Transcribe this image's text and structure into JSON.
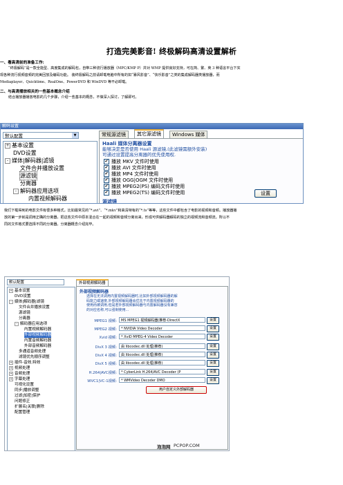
{
  "title": "打造完美影音! 终极解码高清设置解析",
  "section1": {
    "heading": "一、看高清前的准备工作:",
    "lines": [
      "“终极解码”是一款全能型、高度集成的解码包，自带三种流行播放器（MPC/KMP P）并对 WMP 提供良好支持，可在简、繁、英 3 种语言平台下实",
      "现各种流行视频音频的完美回放及编码功能。 装终极解码之前请卸载电脑中所有的如“暴风影音”、“快乐影音”之类的集成解码器类播放器，而",
      "Mediaplayer、Quicktime、RealOne、PowerDVD 和 WinDVD 等不必卸载。"
    ]
  },
  "section2": {
    "heading": "二、与高清播放相关的一些基本概念介绍",
    "line": "结合播放器播放电影的几个步骤，介绍一些基本的概念，不做深入探讨，了解即可。"
  },
  "screenshot1": {
    "window_title": "解码设置",
    "profile": "默认配置",
    "tree": [
      {
        "text": "基本设置",
        "box": "+"
      },
      {
        "text": "DVD设置",
        "box": ""
      },
      {
        "text": "媒体|解码器|滤镜",
        "box": "-"
      },
      {
        "text": "文件合并播放设置",
        "box": ""
      },
      {
        "text": "源滤镜",
        "box": "",
        "selected": true
      },
      {
        "text": "分离器",
        "box": ""
      },
      {
        "text": "解码器应用选项",
        "box": "-"
      },
      {
        "text": "内置视频解码器",
        "box": ""
      },
      {
        "text": "外部视频解码器",
        "box": ""
      },
      {
        "text": "内置音频解码器",
        "box": ""
      },
      {
        "text": "外部音频解码器",
        "box": ""
      },
      {
        "text": "多通道音频处理",
        "box": ""
      }
    ],
    "tabs": [
      "常规源滤镜",
      "其它源滤镜",
      "Windows 媒体"
    ],
    "group_title": "Haali 媒体分离器设置",
    "group_desc": [
      "能够决定是否使用 Haali 源滤镜,(此滤镜需额外安装)",
      "可通过设置提高分离器的优先使用权."
    ],
    "options": [
      "播放 MKV 文件时使用",
      "播放 AVI 文件时使用",
      "播放 MP4 文件时使用",
      "播放 OGG|OGM 文件时使用",
      "播放 MPEG2(PS) 编码文件时使用",
      "播放 MPEG2(TS) 编码文件时使用"
    ],
    "settings_button": "设置",
    "next_group_title": "源滤镜"
  },
  "paragraph3": [
    "我们下载得到的电影文件有很多种格式，比如最常见的“*.avi”、“*.mkv”和高清特有的“*.ts”等等，这些文件中都包含了电影的视频和音频。播放器播",
    "放的第一步就是调用正确的分离器，把这些文件中原本混合在一起的视频和音频分离出来，形成可供解码器解码的独立的视频流和音频流。所以不",
    "同的文件格式要选择不同的分离器。分离器概念介绍完毕。"
  ],
  "screenshot2": {
    "profile": "默认配置",
    "tab": "外部视频解码器",
    "tree": [
      {
        "text": "基本设置",
        "box": "+"
      },
      {
        "text": "DVD设置",
        "box": ""
      },
      {
        "text": "媒体|解码器|滤镜",
        "box": "-"
      },
      {
        "text": "文件合并播放设置",
        "box": ""
      },
      {
        "text": "源滤镜",
        "box": ""
      },
      {
        "text": "分离器",
        "box": ""
      },
      {
        "text": "解码器应用选项",
        "box": "-"
      },
      {
        "text": "内置视频解码器",
        "box": ""
      },
      {
        "text": "外部视频解码器",
        "box": "",
        "selected": true
      },
      {
        "text": "内置音频解码器",
        "box": ""
      },
      {
        "text": "外部音频解码器",
        "box": ""
      },
      {
        "text": "多通道音频处理",
        "box": ""
      },
      {
        "text": "滤镜优先顺序调整",
        "box": ""
      },
      {
        "text": "插件-音效,特效",
        "box": "+"
      },
      {
        "text": "视频处理",
        "box": "+"
      },
      {
        "text": "音频处理",
        "box": "+"
      },
      {
        "text": "字幕处理",
        "box": "+"
      },
      {
        "text": "可视化设置",
        "box": ""
      },
      {
        "text": "同步|播放调整",
        "box": ""
      },
      {
        "text": "过滤|加密|保护",
        "box": ""
      },
      {
        "text": "问题修正",
        "box": ""
      },
      {
        "text": "扩展名|关联|删除",
        "box": ""
      },
      {
        "text": "配置管理",
        "box": ""
      }
    ],
    "group_title": "外部视频解码器",
    "group_desc": [
      "选择在无法调用内置视频解码器时,比如外部视频解码器的解",
      "码能力或速度,外部视频解码器会优先于内置视频解码器的",
      "使用而被调用,但是若外部视频解码器与内置解码器没有兼容",
      "的对应名称,可以强制使用..."
    ],
    "rows": [
      {
        "label": "MPEG1 视频:",
        "value": "MS MPEG1 视频解码器(推荐-DirectX"
      },
      {
        "label": "MPEG2 视频:",
        "value": "* NVIDIA Video Decoder"
      },
      {
        "label": "Xvid 视频:",
        "value": "* XviD MPEG-4 Video Decoder"
      },
      {
        "label": "DivX 3 视频:",
        "value": "由 libcodec.dll 处理(推荐)"
      },
      {
        "label": "DivX 4 视频:",
        "value": "由 libcodec.dll 处理(推荐)"
      },
      {
        "label": "DivX 5 视频:",
        "value": "由 libcodec.dll 处理(推荐)"
      },
      {
        "label": "H.264|AVC视频:",
        "value": "* CyberLink H.264/AVC Decoder (P"
      },
      {
        "label": "WVC1|VC-1视频:",
        "value": "* WMVideo Decoder DMO"
      }
    ],
    "settings_label": "设置",
    "custom_button": "用户自定义外部解码器",
    "watermark_left": "泡泡网",
    "watermark_right": "PCPOP.COM"
  }
}
